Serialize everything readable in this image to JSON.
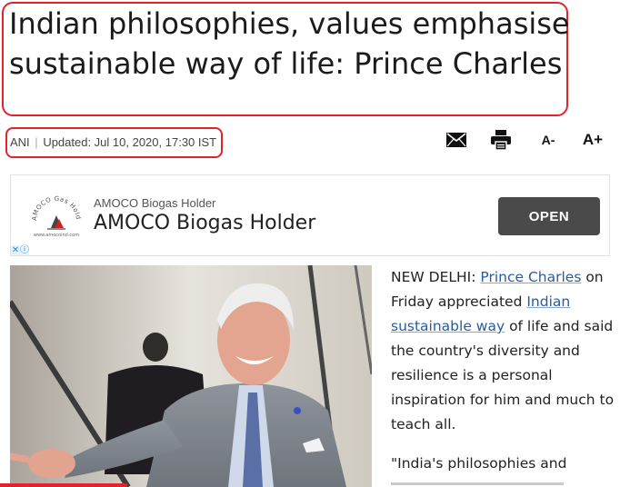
{
  "article": {
    "headline": "Indian philosophies, values emphasise sustainable way of life: Prince Charles",
    "source": "ANI",
    "separator": "|",
    "updated": "Updated: Jul 10, 2020, 17:30 IST"
  },
  "toolbar": {
    "email_icon": "envelope-icon",
    "print_icon": "printer-icon",
    "font_decrease_label": "A-",
    "font_increase_label": "A+"
  },
  "ad": {
    "advertiser": "AMOCO Biogas Holder",
    "headline": "AMOCO Biogas Holder",
    "cta_label": "OPEN",
    "logo_text": "AMOCO Gas Holder",
    "logo_url_text": "www.amocoind.com",
    "choices_close": "✕",
    "choices_info": "ⓘ"
  },
  "body": {
    "p1_prefix": "NEW DELHI: ",
    "link1": "Prince Charles",
    "p1_mid1": " on Friday appreciated ",
    "link2": "Indian sustainable way",
    "p1_rest": " of life and said the country's diversity and resilience is a personal inspiration for him and much to teach all.",
    "p2_start": "\"India's philosophies and"
  },
  "colors": {
    "highlight_red": "#e0242a",
    "link_blue": "#245ca8",
    "ad_button": "#4a4a4a"
  }
}
